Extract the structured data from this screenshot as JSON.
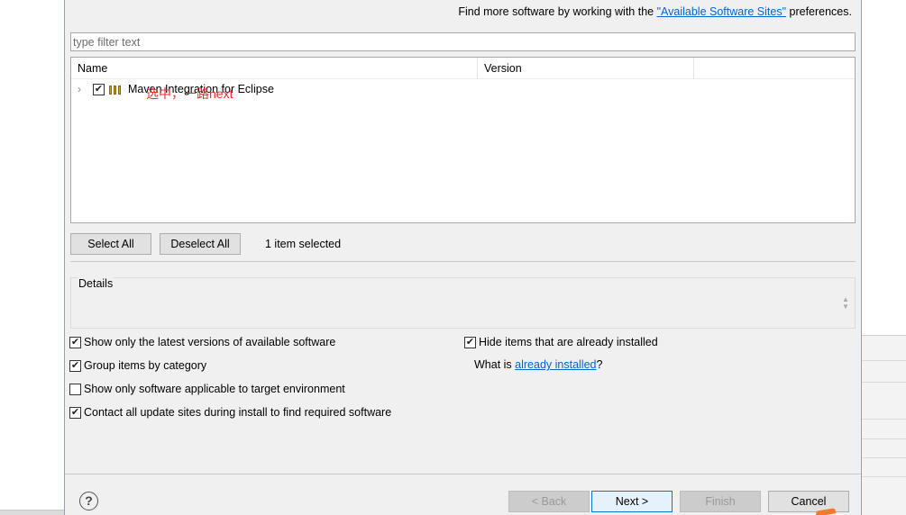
{
  "header": {
    "find_more_prefix": "Find more software by working with the ",
    "find_more_link": "\"Available Software Sites\"",
    "find_more_suffix": " preferences."
  },
  "filter": {
    "placeholder": "type filter text",
    "value": ""
  },
  "tree": {
    "columns": [
      "Name",
      "Version",
      ""
    ],
    "items": [
      {
        "label": "Maven Integration for Eclipse",
        "checked": true,
        "version": ""
      }
    ],
    "annotation": "选中，一路next"
  },
  "selection": {
    "select_all": "Select All",
    "deselect_all": "Deselect All",
    "count_text": "1 item selected"
  },
  "details": {
    "title": "Details"
  },
  "options": {
    "latest_versions": {
      "label": "Show only the latest versions of available software",
      "checked": true
    },
    "group_by_category": {
      "label": "Group items by category",
      "checked": true
    },
    "target_env": {
      "label": "Show only software applicable to target environment",
      "checked": false
    },
    "contact_sites": {
      "label": "Contact all update sites during install to find required software",
      "checked": true
    },
    "hide_installed": {
      "label": "Hide items that are already installed",
      "checked": true
    },
    "what_is_prefix": "What is ",
    "what_is_link": "already installed",
    "what_is_suffix": "?"
  },
  "footer": {
    "help": "?",
    "back": "< Back",
    "next": "Next >",
    "finish": "Finish",
    "cancel": "Cancel"
  },
  "colors": {
    "link": "#0066cc",
    "annotation": "#e03030",
    "default_button_border": "#0078d7"
  },
  "icons": {
    "checkmark": "check-icon",
    "expander": "chevron-right-icon",
    "package": "package-icon",
    "help": "help-icon"
  }
}
